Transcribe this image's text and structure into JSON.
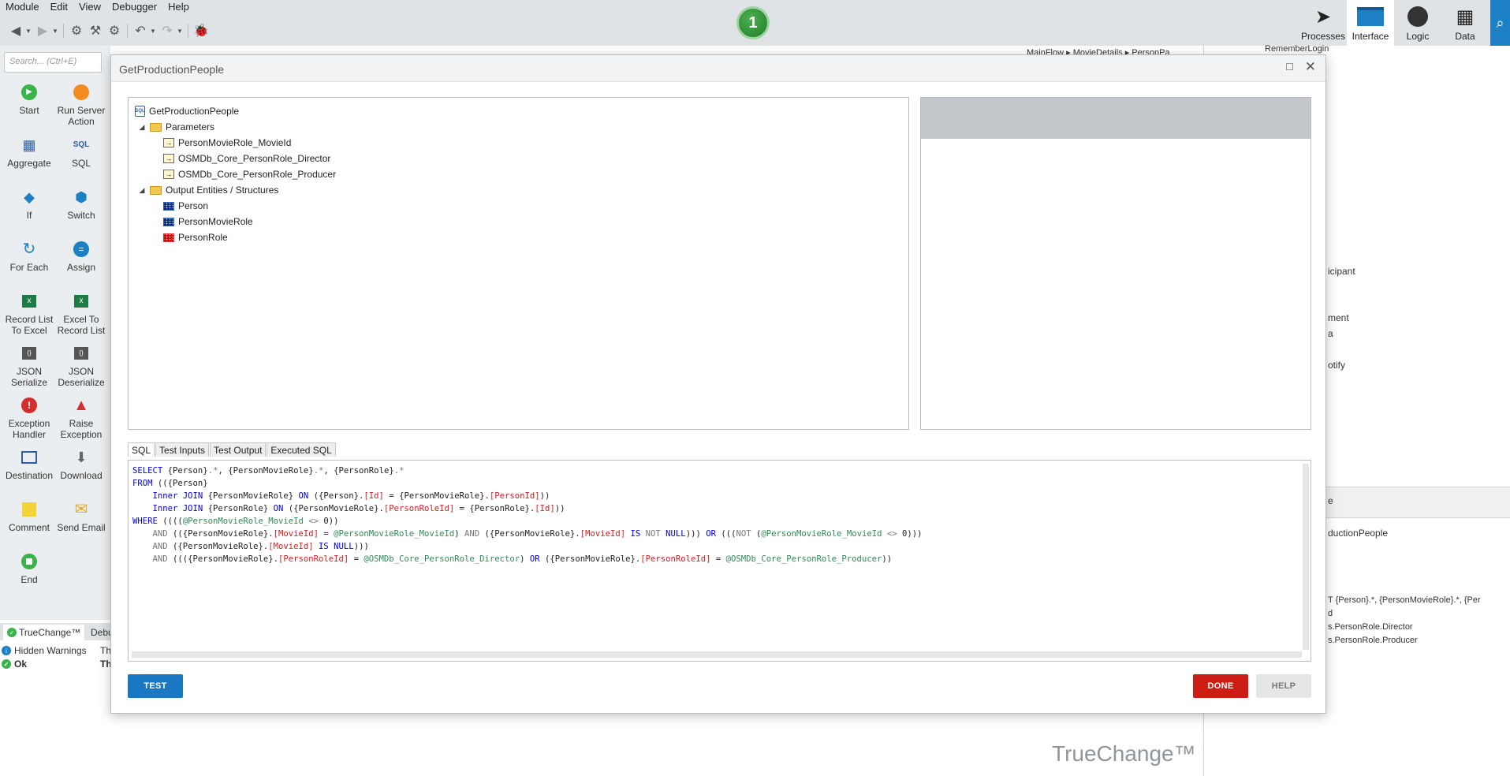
{
  "menu": [
    "Module",
    "Edit",
    "View",
    "Debugger",
    "Help"
  ],
  "step_badge": "1",
  "top_nav": [
    {
      "label": "Processes",
      "icon": "processes-icon"
    },
    {
      "label": "Interface",
      "icon": "interface-icon"
    },
    {
      "label": "Logic",
      "icon": "logic-icon"
    },
    {
      "label": "Data",
      "icon": "data-icon"
    }
  ],
  "toolbox": {
    "search_placeholder": "Search... (Ctrl+E)",
    "tools": [
      {
        "label": "Start"
      },
      {
        "label": "Run Server Action"
      },
      {
        "label": "Aggregate"
      },
      {
        "label": "SQL"
      },
      {
        "label": "If"
      },
      {
        "label": "Switch"
      },
      {
        "label": "For Each"
      },
      {
        "label": "Assign"
      },
      {
        "label": "Record List To Excel"
      },
      {
        "label": "Excel To Record List"
      },
      {
        "label": "JSON Serialize"
      },
      {
        "label": "JSON Deserialize"
      },
      {
        "label": "Exception Handler"
      },
      {
        "label": "Raise Exception"
      },
      {
        "label": "Destination"
      },
      {
        "label": "Download"
      },
      {
        "label": "Comment"
      },
      {
        "label": "Send Email"
      },
      {
        "label": "End"
      }
    ]
  },
  "lower_panel": {
    "tabs": [
      "TrueChange™",
      "Debu"
    ],
    "rows": [
      {
        "label": "Hidden Warnings",
        "detail": "Th"
      },
      {
        "label": "Ok",
        "detail": "Th"
      }
    ]
  },
  "background": {
    "top_partial": "RememberLogin",
    "canvas_partial": "MainFlow ▸ MovieDetails ▸ PersonPa",
    "right_partials": [
      "icipant",
      "ment",
      "a",
      "otify"
    ],
    "prop_header": "e",
    "prop_rows": [
      "ductionPeople",
      "",
      "",
      "T {Person}.*, {PersonMovieRole}.*, {Per",
      "d",
      "s.PersonRole.Director",
      "s.PersonRole.Producer",
      ""
    ],
    "watermark": "TrueChange™"
  },
  "dialog": {
    "title": "GetProductionPeople",
    "tree": {
      "root": "GetProductionPeople",
      "parameters_label": "Parameters",
      "parameters": [
        "PersonMovieRole_MovieId",
        "OSMDb_Core_PersonRole_Director",
        "OSMDb_Core_PersonRole_Producer"
      ],
      "outputs_label": "Output Entities / Structures",
      "outputs": [
        "Person",
        "PersonMovieRole",
        "PersonRole"
      ]
    },
    "sql_tabs": [
      "SQL",
      "Test Inputs",
      "Test Output",
      "Executed SQL"
    ],
    "sql_lines": [
      "SELECT {Person}.*, {PersonMovieRole}.*, {PersonRole}.*",
      "FROM (({Person}",
      "    Inner JOIN {PersonMovieRole} ON ({Person}.[Id] = {PersonMovieRole}.[PersonId]))",
      "    Inner JOIN {PersonRole} ON ({PersonMovieRole}.[PersonRoleId] = {PersonRole}.[Id]))",
      "WHERE ((((@PersonMovieRole_MovieId <> 0))",
      "    AND (({PersonMovieRole}.[MovieId] = @PersonMovieRole_MovieId) AND ({PersonMovieRole}.[MovieId] IS NOT NULL))) OR (((NOT (@PersonMovieRole_MovieId <> 0)))",
      "    AND ({PersonMovieRole}.[MovieId] IS NULL)))",
      "    AND ((({PersonMovieRole}.[PersonRoleId] = @OSMDb_Core_PersonRole_Director) OR ({PersonMovieRole}.[PersonRoleId] = @OSMDb_Core_PersonRole_Producer))"
    ],
    "buttons": {
      "test": "TEST",
      "done": "DONE",
      "help": "HELP"
    }
  }
}
